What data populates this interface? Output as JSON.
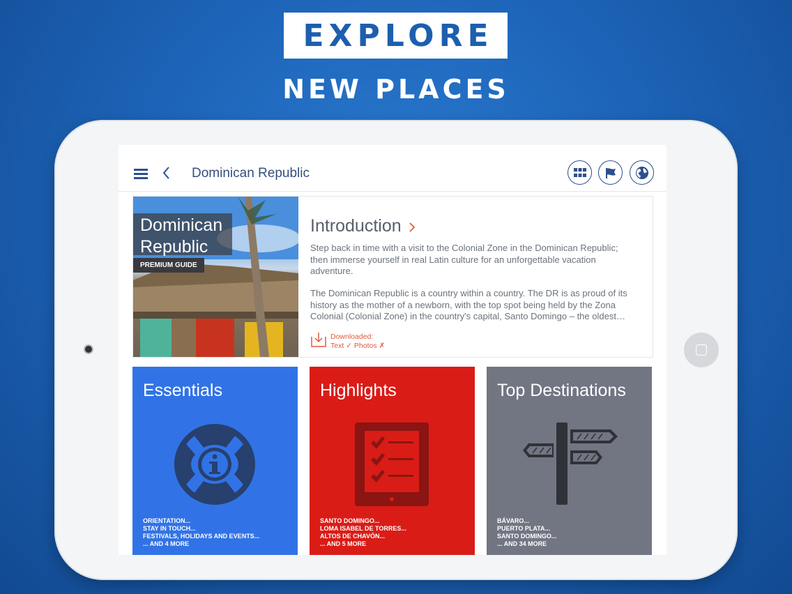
{
  "promo": {
    "headline": "EXPLORE",
    "subheadline": "NEW PLACES"
  },
  "navbar": {
    "title": "Dominican Republic"
  },
  "guide": {
    "title_line1": "Dominican",
    "title_line2": "Republic",
    "badge": "PREMIUM GUIDE"
  },
  "intro": {
    "heading": "Introduction",
    "paragraph1": "Step back in time with a visit to the Colonial Zone in the Dominican Republic; then immerse yourself in real Latin culture for an unforgettable vacation adventure.",
    "paragraph2": "The Dominican Republic is a country within a country. The DR is as proud of its history as the mother of a newborn, with the top spot being held by the Zona Colonial (Colonial Zone) in the country's capital, Santo Domingo – the oldest…",
    "download_label": "Downloaded:",
    "download_status": "Text ✓  Photos ✗"
  },
  "tiles": [
    {
      "title": "Essentials",
      "color": "#3173e6",
      "items": [
        "ORIENTATION...",
        "STAY IN TOUCH...",
        "FESTIVALS, HOLIDAYS AND EVENTS...",
        "... AND 4 MORE"
      ]
    },
    {
      "title": "Highlights",
      "color": "#da1c17",
      "items": [
        "SANTO DOMINGO...",
        "LOMA ISABEL DE TORRES...",
        "ALTOS DE CHAVÓN...",
        "... AND 5 MORE"
      ]
    },
    {
      "title": "Top Destinations",
      "color": "#727682",
      "items": [
        "BÁVARO...",
        "PUERTO PLATA...",
        "SANTO DOMINGO...",
        "... AND 34 MORE"
      ]
    }
  ],
  "icons": [
    "menu-icon",
    "back-icon",
    "grid-icon",
    "flag-icon",
    "globe-icon",
    "chevron-right-icon",
    "download-icon",
    "lifebuoy-info-icon",
    "checklist-icon",
    "signpost-icon"
  ],
  "colors": {
    "brand_blue": "#1d64b8",
    "nav_accent": "#2d4f8e",
    "download_accent": "#e05a3a"
  }
}
